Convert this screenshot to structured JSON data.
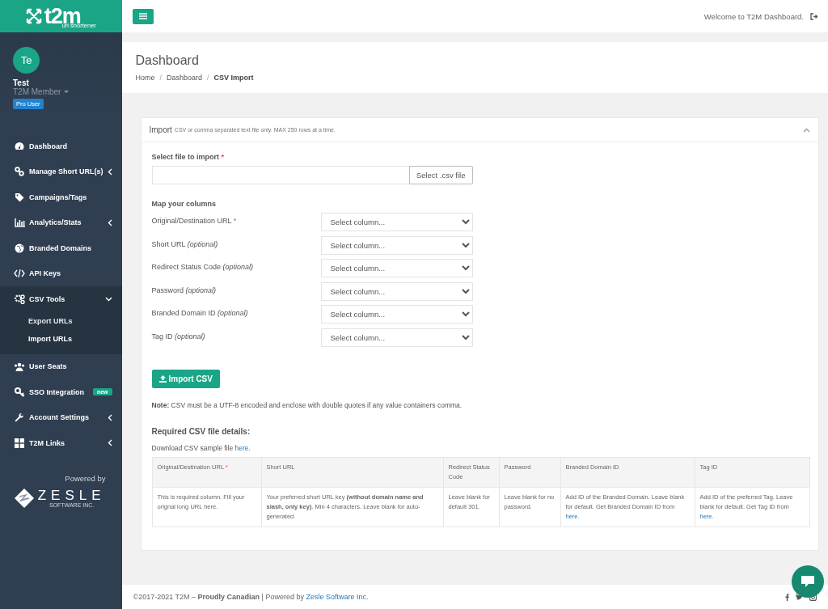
{
  "sidebar": {
    "logo": {
      "name": "t2m",
      "tagline": "url shortener"
    },
    "user": {
      "initials": "Te",
      "name": "Test",
      "role": "T2M Member",
      "badge": "Pro User"
    },
    "nav": [
      {
        "kind": "link",
        "label": "Dashboard",
        "selected": false
      },
      {
        "kind": "group",
        "label": "Manage Short URL(s)",
        "selected": false,
        "expanded": false
      },
      {
        "kind": "link",
        "label": "Campaigns/Tags",
        "selected": false
      },
      {
        "kind": "group",
        "label": "Analytics/Stats",
        "selected": false,
        "expanded": false
      },
      {
        "kind": "link",
        "label": "Branded Domains",
        "selected": false
      },
      {
        "kind": "link",
        "label": "API Keys",
        "selected": false
      },
      {
        "kind": "group",
        "label": "CSV Tools",
        "selected": true,
        "expanded": true,
        "children": [
          {
            "label": "Export URLs",
            "selected": false
          },
          {
            "label": "Import URLs",
            "selected": true
          }
        ]
      },
      {
        "kind": "link",
        "label": "User Seats",
        "selected": false
      },
      {
        "kind": "link",
        "label": "SSO Integration",
        "selected": false,
        "badge": "new"
      },
      {
        "kind": "group",
        "label": "Account Settings",
        "selected": false,
        "expanded": false
      },
      {
        "kind": "group",
        "label": "T2M Links",
        "selected": false,
        "expanded": false
      }
    ],
    "powered_by": {
      "label": "Powered by",
      "brand": "ZESLE",
      "brand_sub": "SOFTWARE INC."
    }
  },
  "topbar": {
    "welcome": "Welcome to T2M Dashboard."
  },
  "header": {
    "title": "Dashboard",
    "separator": "/",
    "breadcrumbs": [
      {
        "label": "Home",
        "current": false
      },
      {
        "label": "Dashboard",
        "current": false
      },
      {
        "label": "CSV Import",
        "current": true
      }
    ]
  },
  "import_card": {
    "title": "Import",
    "subtitle": "CSV or comma separated text file only. MAX 250 rows at a time.",
    "expanded": true,
    "file": {
      "label": "Select file to import",
      "note": "*",
      "required": true,
      "button": "Select .csv file"
    },
    "mapping_heading": "Map your columns",
    "mappings": [
      {
        "label": "Original/Destination URL",
        "note": "*",
        "required": true,
        "placeholder": "Select column..."
      },
      {
        "label": "Short URL",
        "note": "(optional)",
        "required": false,
        "placeholder": "Select column..."
      },
      {
        "label": "Redirect Status Code",
        "note": "(optional)",
        "required": false,
        "placeholder": "Select column..."
      },
      {
        "label": "Password",
        "note": "(optional)",
        "required": false,
        "placeholder": "Select column..."
      },
      {
        "label": "Branded Domain ID",
        "note": "(optional)",
        "required": false,
        "placeholder": "Select column..."
      },
      {
        "label": "Tag ID",
        "note": "(optional)",
        "required": false,
        "placeholder": "Select column..."
      }
    ],
    "import_button": "Import CSV",
    "note": "**Note:** CSV must be a UTF-8 encoded and enclose with double quotes if any value containers comma.",
    "details_heading": "Required CSV file details:",
    "download": {
      "text": "Download CSV sample file",
      "link": "here",
      "suffix": "."
    },
    "table": {
      "columns": [
        {
          "label": "Original/Destination URL",
          "note": "*"
        },
        {
          "label": "Short URL"
        },
        {
          "label": "Redirect Status Code"
        },
        {
          "label": "Password"
        },
        {
          "label": "Branded Domain ID"
        },
        {
          "label": "Tag ID"
        }
      ],
      "rows": [
        [
          {
            "text": "This is required column. Fill your orignal long URL here."
          },
          {
            "text": "Your preferred short URL key **(without domain name and slash, only key)**. Min 4 characters. Leave blank for auto-generated."
          },
          {
            "text": "Leave blank for default 301."
          },
          {
            "text": "Leave blank for no password."
          },
          {
            "text": "Add ID of the Branded Domain. Leave blank for default. Get Branded Domain ID from",
            "link": "here."
          },
          {
            "text": "Add ID of the preferred Tag. Leave blank for default. Get Tag ID from",
            "link": "here."
          }
        ]
      ]
    }
  },
  "footer": {
    "text": "©2017-2021 T2M – **Proudly Canadian** | Powered by",
    "link": "Zesle Software Inc."
  }
}
